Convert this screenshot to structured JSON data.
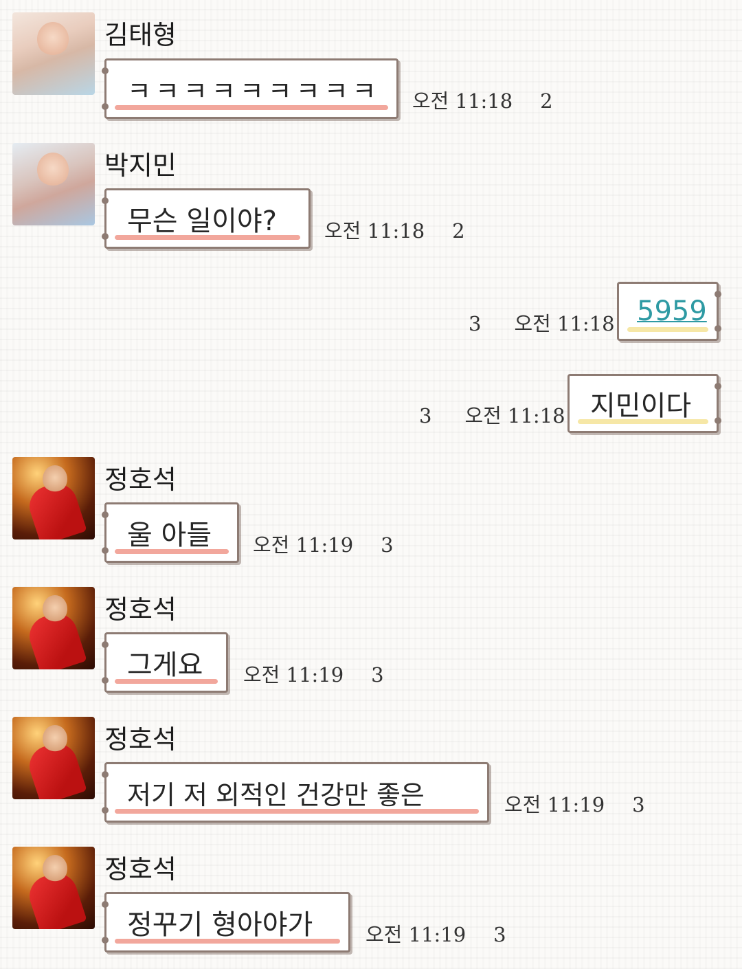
{
  "messages": [
    {
      "sender": "김태형",
      "text": "ㅋㅋㅋㅋㅋㅋㅋㅋㅋ",
      "time": "오전 11:18",
      "unread": "2"
    },
    {
      "sender": "박지민",
      "text": "무슨 일이야?",
      "time": "오전 11:18",
      "unread": "2"
    },
    {
      "sender": "me",
      "text": "5959",
      "time": "오전 11:18",
      "unread": "3"
    },
    {
      "sender": "me",
      "text": "지민이다",
      "time": "오전 11:18",
      "unread": "3"
    },
    {
      "sender": "정호석",
      "text": "울 아들",
      "time": "오전 11:19",
      "unread": "3"
    },
    {
      "sender": "정호석",
      "text": "그게요",
      "time": "오전 11:19",
      "unread": "3"
    },
    {
      "sender": "정호석",
      "text": "저기 저 외적인 건강만 좋은",
      "time": "오전 11:19",
      "unread": "3"
    },
    {
      "sender": "정호석",
      "text": "정꾸기 형아야가",
      "time": "오전 11:19",
      "unread": "3"
    }
  ],
  "colors": {
    "bubble_border": "#8d7b73",
    "incoming_highlight": "#f2a79c",
    "outgoing_highlight": "#f6e7a6",
    "link": "#2e9aa3"
  }
}
